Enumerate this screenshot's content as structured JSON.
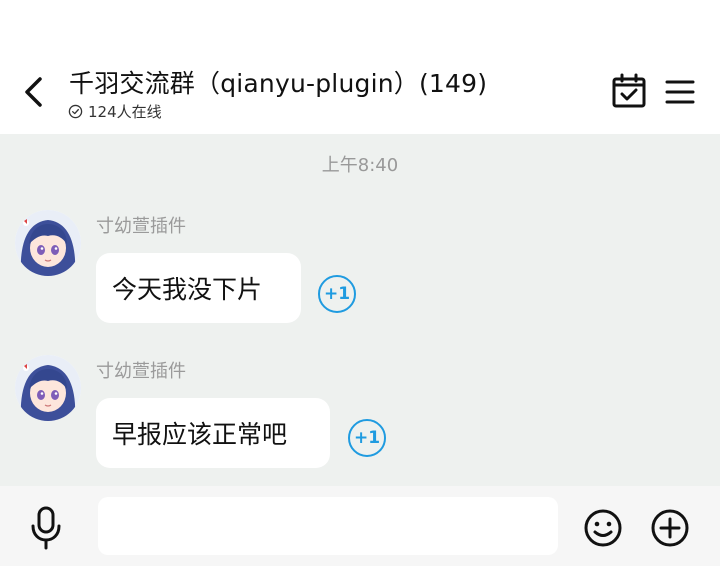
{
  "header": {
    "title": "千羽交流群（qianyu-plugin）(149)",
    "online_status": "124人在线"
  },
  "chat": {
    "timestamp": "上午8:40",
    "messages": [
      {
        "sender": "寸幼萱插件",
        "text": "今天我没下片",
        "plus_one": "+1"
      },
      {
        "sender": "寸幼萱插件",
        "text": "早报应该正常吧",
        "plus_one": "+1"
      }
    ]
  },
  "input": {
    "value": "",
    "placeholder": ""
  },
  "colors": {
    "accent": "#1f9be0",
    "chat_bg": "#eef1ef",
    "bubble": "#ffffff"
  },
  "icons": {
    "back": "back-arrow-icon",
    "calendar": "calendar-check-icon",
    "menu": "menu-icon",
    "online": "check-circle-icon",
    "mic": "microphone-icon",
    "emoji": "smiley-icon",
    "add": "plus-circle-icon"
  }
}
